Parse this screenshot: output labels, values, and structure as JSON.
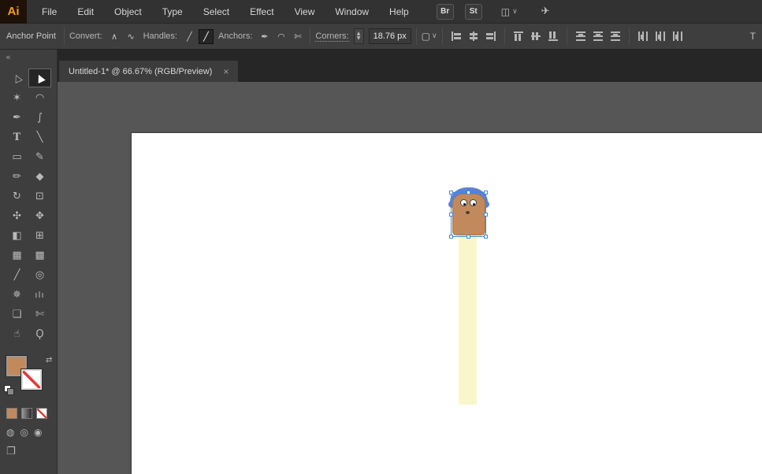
{
  "colors": {
    "logo_orange": "#f59b1e",
    "selection_blue": "#3f8ae0",
    "head_tan": "#c28a5c",
    "hat_blue": "#5b80d6",
    "body_yellow": "#f9f7c9",
    "none_red": "#e03a3a"
  },
  "menubar": {
    "logo": "Ai",
    "menus": [
      {
        "label": "File"
      },
      {
        "label": "Edit"
      },
      {
        "label": "Object"
      },
      {
        "label": "Type"
      },
      {
        "label": "Select"
      },
      {
        "label": "Effect"
      },
      {
        "label": "View"
      },
      {
        "label": "Window"
      },
      {
        "label": "Help"
      }
    ],
    "bridge_label": "Br",
    "stock_label": "St",
    "workspace_icon": "◫",
    "workspace_chevron": "∨",
    "gpu_icon": "✈"
  },
  "controlbar": {
    "context_title": "Anchor Point",
    "convert_label": "Convert:",
    "convert_icons": [
      {
        "name": "convert-to-corner-icon",
        "glyph": "∧"
      },
      {
        "name": "convert-to-smooth-icon",
        "glyph": "∿"
      }
    ],
    "handles_label": "Handles:",
    "handles_icons": [
      {
        "name": "hide-handles-icon",
        "glyph": "╱"
      },
      {
        "name": "show-handles-icon",
        "glyph": "╱",
        "active": true
      }
    ],
    "anchors_label": "Anchors:",
    "anchors_icons": [
      {
        "name": "remove-anchor-icon",
        "glyph": "✒"
      },
      {
        "name": "connect-anchors-icon",
        "glyph": "◠"
      },
      {
        "name": "cut-path-icon",
        "glyph": "✄"
      }
    ],
    "corners_label": "Corners:",
    "stepper_up": "▲",
    "stepper_down": "▼",
    "corners_value": "18.76 px",
    "isolate_icon": "▢",
    "isolate_chevron": "∨",
    "align_groups": [
      {
        "icons": [
          {
            "name": "horizontal-align-left-icon",
            "kind": "hal"
          },
          {
            "name": "horizontal-align-center-icon",
            "kind": "hac"
          },
          {
            "name": "horizontal-align-right-icon",
            "kind": "har"
          }
        ]
      },
      {
        "icons": [
          {
            "name": "vertical-align-top-icon",
            "kind": "vat"
          },
          {
            "name": "vertical-align-middle-icon",
            "kind": "vam"
          },
          {
            "name": "vertical-align-bottom-icon",
            "kind": "vab"
          }
        ]
      },
      {
        "icons": [
          {
            "name": "distribute-top-icon",
            "kind": "vdt"
          },
          {
            "name": "distribute-middle-icon",
            "kind": "vdm"
          },
          {
            "name": "distribute-bottom-icon",
            "kind": "vdb"
          }
        ]
      },
      {
        "icons": [
          {
            "name": "distribute-left-icon",
            "kind": "hdl"
          },
          {
            "name": "distribute-center-icon",
            "kind": "hdc"
          },
          {
            "name": "distribute-right-icon",
            "kind": "hdr"
          }
        ]
      }
    ],
    "transform_truncated": "T"
  },
  "tabbar": {
    "tab_title": "Untitled-1* @ 66.67% (RGB/Preview)",
    "close": "×"
  },
  "toolbar": {
    "collapse": "«",
    "tools": [
      {
        "name": "direct-selection-tool",
        "glyph": "▷"
      },
      {
        "name": "selection-tool",
        "glyph": "▶",
        "active": true
      },
      {
        "name": "magic-wand-tool",
        "glyph": "✶"
      },
      {
        "name": "lasso-tool",
        "glyph": "◠"
      },
      {
        "name": "pen-tool",
        "glyph": "✒"
      },
      {
        "name": "curvature-tool",
        "glyph": "∫"
      },
      {
        "name": "type-tool",
        "glyph": "T"
      },
      {
        "name": "line-segment-tool",
        "glyph": "╲"
      },
      {
        "name": "rectangle-tool",
        "glyph": "▭"
      },
      {
        "name": "paintbrush-tool",
        "glyph": "✎"
      },
      {
        "name": "shaper-tool",
        "glyph": "✏"
      },
      {
        "name": "eraser-tool",
        "glyph": "◆"
      },
      {
        "name": "rotate-tool",
        "glyph": "↻"
      },
      {
        "name": "scale-tool",
        "glyph": "⊡"
      },
      {
        "name": "width-tool",
        "glyph": "✣"
      },
      {
        "name": "free-transform-tool",
        "glyph": "✥"
      },
      {
        "name": "shape-builder-tool",
        "glyph": "◧"
      },
      {
        "name": "perspective-grid-tool",
        "glyph": "⊞"
      },
      {
        "name": "mesh-tool",
        "glyph": "▦"
      },
      {
        "name": "gradient-tool",
        "glyph": "▩"
      },
      {
        "name": "eyedropper-tool",
        "glyph": "╱"
      },
      {
        "name": "blend-tool",
        "glyph": "◎"
      },
      {
        "name": "symbol-sprayer-tool",
        "glyph": "✵"
      },
      {
        "name": "column-graph-tool",
        "glyph": "ılı"
      },
      {
        "name": "artboard-tool",
        "glyph": "❏"
      },
      {
        "name": "slice-tool",
        "glyph": "✄"
      },
      {
        "name": "hand-tool",
        "glyph": "☝"
      },
      {
        "name": "zoom-tool",
        "glyph": "Ϙ"
      }
    ],
    "swap_icon": "⇄",
    "draw_modes": [
      {
        "name": "draw-normal-icon",
        "glyph": "◍"
      },
      {
        "name": "draw-behind-icon",
        "glyph": "◎"
      },
      {
        "name": "draw-inside-icon",
        "glyph": "◉"
      }
    ],
    "screen_mode_icon": "❐"
  }
}
